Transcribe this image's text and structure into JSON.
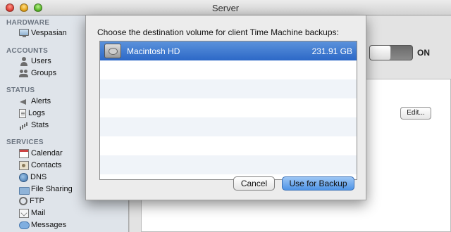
{
  "window": {
    "title": "Server"
  },
  "sidebar": {
    "sections": [
      {
        "label": "HARDWARE",
        "items": [
          {
            "label": "Vespasian",
            "icon": "display-icon"
          }
        ]
      },
      {
        "label": "ACCOUNTS",
        "items": [
          {
            "label": "Users",
            "icon": "user-icon"
          },
          {
            "label": "Groups",
            "icon": "group-icon"
          }
        ]
      },
      {
        "label": "STATUS",
        "items": [
          {
            "label": "Alerts",
            "icon": "megaphone-icon"
          },
          {
            "label": "Logs",
            "icon": "log-icon"
          },
          {
            "label": "Stats",
            "icon": "chart-icon"
          }
        ]
      },
      {
        "label": "SERVICES",
        "items": [
          {
            "label": "Calendar",
            "icon": "calendar-icon"
          },
          {
            "label": "Contacts",
            "icon": "contacts-icon"
          },
          {
            "label": "DNS",
            "icon": "globe-icon"
          },
          {
            "label": "File Sharing",
            "icon": "folder-icon"
          },
          {
            "label": "FTP",
            "icon": "ftp-icon"
          },
          {
            "label": "Mail",
            "icon": "mail-icon"
          },
          {
            "label": "Messages",
            "icon": "messages-icon"
          }
        ]
      }
    ]
  },
  "content": {
    "toggle": {
      "label": "ON",
      "state": "on"
    },
    "edit_label": "Edit..."
  },
  "sheet": {
    "prompt": "Choose the destination volume for client Time Machine backups:",
    "volumes": [
      {
        "name": "Macintosh HD",
        "size": "231.91 GB",
        "selected": true
      }
    ],
    "cancel_label": "Cancel",
    "confirm_label": "Use for Backup"
  },
  "colors": {
    "selection": "#2c68c7",
    "primary_button": "#4f94e6",
    "sidebar_bg": "#dfe4ea"
  }
}
